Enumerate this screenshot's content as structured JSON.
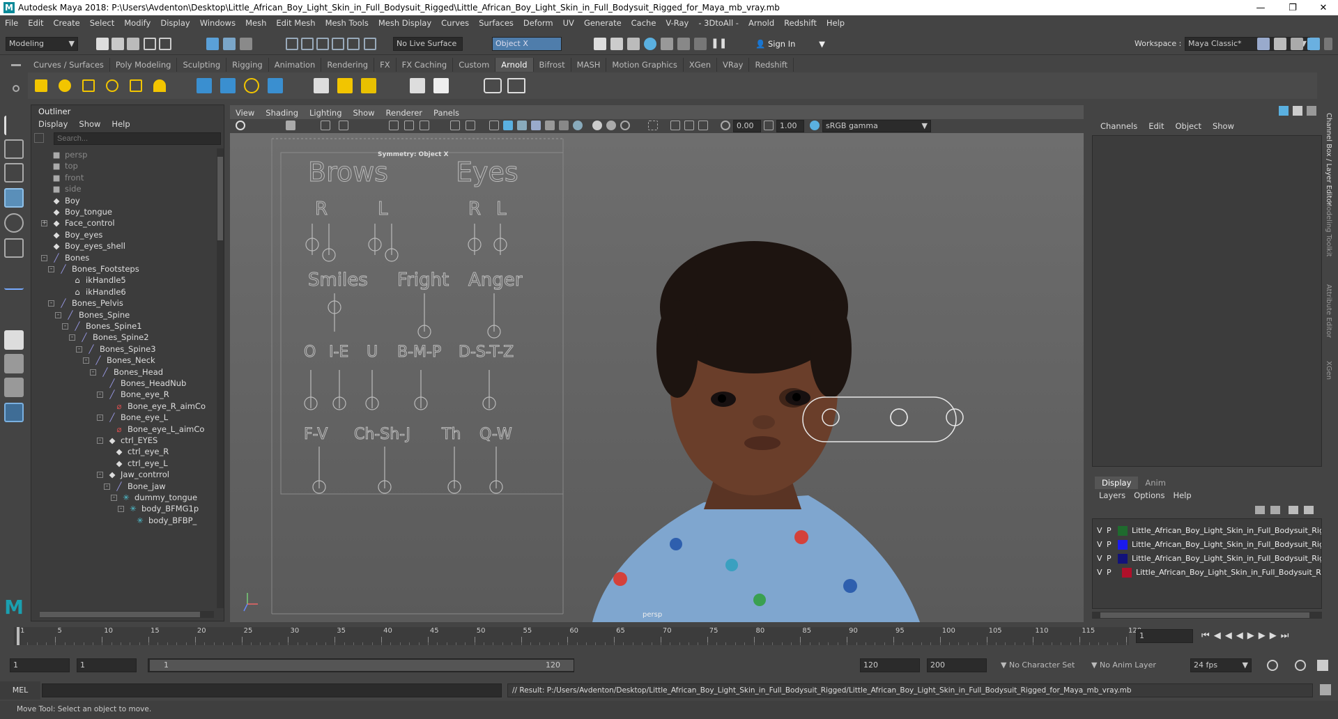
{
  "window": {
    "title": "Autodesk Maya 2018: P:\\Users\\Avdenton\\Desktop\\Little_African_Boy_Light_Skin_in_Full_Bodysuit_Rigged\\Little_African_Boy_Light_Skin_in_Full_Bodysuit_Rigged_for_Maya_mb_vray.mb",
    "app_logo": "M"
  },
  "menubar": [
    "File",
    "Edit",
    "Create",
    "Select",
    "Modify",
    "Display",
    "Windows",
    "Mesh",
    "Edit Mesh",
    "Mesh Tools",
    "Mesh Display",
    "Curves",
    "Surfaces",
    "Deform",
    "UV",
    "Generate",
    "Cache",
    "V-Ray",
    "- 3DtoAll -",
    "Arnold",
    "Redshift",
    "Help"
  ],
  "statusline": {
    "menuset": "Modeling",
    "live_surface": "No Live Surface",
    "symmetry": "Object X",
    "sign_in": "Sign In",
    "workspace_label": "Workspace :",
    "workspace": "Maya Classic*"
  },
  "shelf_tabs": [
    "Curves / Surfaces",
    "Poly Modeling",
    "Sculpting",
    "Rigging",
    "Animation",
    "Rendering",
    "FX",
    "FX Caching",
    "Custom",
    "Arnold",
    "Bifrost",
    "MASH",
    "Motion Graphics",
    "XGen",
    "VRay",
    "Redshift"
  ],
  "shelf_active": "Arnold",
  "outliner": {
    "title": "Outliner",
    "menu": [
      "Display",
      "Show",
      "Help"
    ],
    "search_placeholder": "Search...",
    "items": [
      "persp",
      "top",
      "front",
      "side",
      "Boy",
      "Boy_tongue",
      "Face_control",
      "Boy_eyes",
      "Boy_eyes_shell",
      "Bones",
      "Bones_Footsteps",
      "ikHandle5",
      "ikHandle6",
      "Bones_Pelvis",
      "Bones_Spine",
      "Bones_Spine1",
      "Bones_Spine2",
      "Bones_Spine3",
      "Bones_Neck",
      "Bones_Head",
      "Bones_HeadNub",
      "Bone_eye_R",
      "Bone_eye_R_aimCo",
      "Bone_eye_L",
      "Bone_eye_L_aimCo",
      "ctrl_EYES",
      "ctrl_eye_R",
      "ctrl_eye_L",
      "Jaw_contrrol",
      "Bone_jaw",
      "dummy_tongue",
      "body_BFMG1p",
      "body_BFBP_"
    ]
  },
  "viewport": {
    "menu": [
      "View",
      "Shading",
      "Lighting",
      "Show",
      "Renderer",
      "Panels"
    ],
    "exposure": "0.00",
    "gamma": "1.00",
    "color_space": "sRGB gamma",
    "symmetry_label": "Symmetry: Object X",
    "camera_label": "persp",
    "face_controls": {
      "headers": [
        "Brows",
        "Eyes"
      ],
      "sub_labels": [
        "R",
        "L",
        "R",
        "L"
      ],
      "row2": [
        "Smiles",
        "Fright",
        "Anger"
      ],
      "row3": [
        "O",
        "I-E",
        "U",
        "B-M-P",
        "D-S-T-Z"
      ],
      "row4": [
        "F-V",
        "Ch-Sh-J",
        "Th",
        "Q-W"
      ]
    }
  },
  "channel_box": {
    "menu": [
      "Channels",
      "Edit",
      "Object",
      "Show"
    ],
    "side_tabs": [
      "Channel Box / Layer Editor",
      "Modeling Toolkit",
      "Attribute Editor",
      "XGen"
    ],
    "layer_tabs": [
      "Display",
      "Anim"
    ],
    "layer_menu": [
      "Layers",
      "Options",
      "Help"
    ],
    "layers": [
      {
        "v": "V",
        "p": "P",
        "name": "Little_African_Boy_Light_Skin_in_Full_Bodysuit_Rigge",
        "color": "#1f6b2e"
      },
      {
        "v": "V",
        "p": "P",
        "name": "Little_African_Boy_Light_Skin_in_Full_Bodysuit_Rigge",
        "color": "#1a1aee"
      },
      {
        "v": "V",
        "p": "P",
        "name": "Little_African_Boy_Light_Skin_in_Full_Bodysuit_Rigge",
        "color": "#12127a"
      },
      {
        "v": "V",
        "p": "P",
        "name": "Little_African_Boy_Light_Skin_in_Full_Bodysuit_Rig",
        "color": "#b0102a"
      }
    ]
  },
  "timeline": {
    "ticks": [
      "1",
      "5",
      "10",
      "15",
      "20",
      "25",
      "30",
      "35",
      "40",
      "45",
      "50",
      "55",
      "60",
      "65",
      "70",
      "75",
      "80",
      "85",
      "90",
      "95",
      "100",
      "105",
      "110",
      "115",
      "120"
    ],
    "current_frame": "1"
  },
  "range": {
    "start": "1",
    "playback_start": "1",
    "slider_start": "1",
    "slider_end": "120",
    "playback_end": "120",
    "end": "200",
    "character_set": "No Character Set",
    "anim_layer": "No Anim Layer",
    "fps": "24 fps"
  },
  "command": {
    "lang": "MEL",
    "result": "// Result: P:/Users/Avdenton/Desktop/Little_African_Boy_Light_Skin_in_Full_Bodysuit_Rigged/Little_African_Boy_Light_Skin_in_Full_Bodysuit_Rigged_for_Maya_mb_vray.mb"
  },
  "help_line": "Move Tool: Select an object to move."
}
